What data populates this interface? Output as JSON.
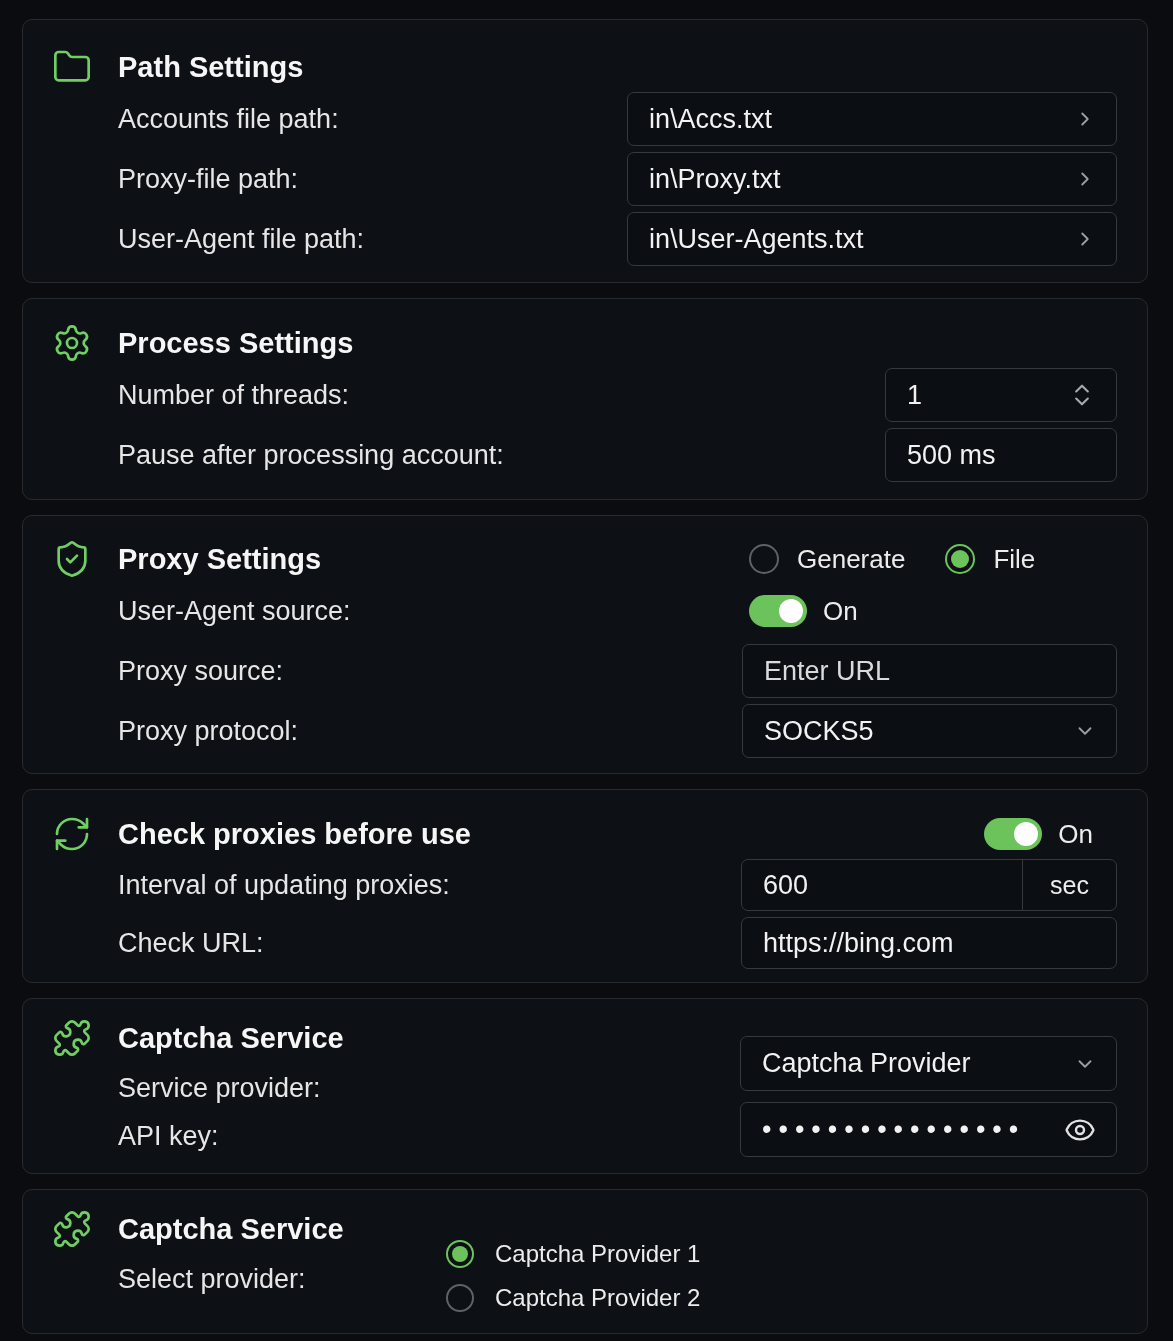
{
  "sections": [
    {
      "kind": "rows",
      "title": "Path Settings",
      "rows": [
        {
          "label": "Accounts file path:",
          "control": {
            "kind": "path",
            "value": "in\\Accs.txt"
          }
        },
        {
          "label": "Proxy-file path:",
          "control": {
            "kind": "path",
            "value": "in\\Proxy.txt"
          }
        },
        {
          "label": "User-Agent file path:",
          "control": {
            "kind": "path",
            "value": "in\\User-Agents.txt"
          }
        }
      ]
    },
    {
      "kind": "rows",
      "title": "Process Settings",
      "rows": [
        {
          "label": "Number of threads:",
          "control": {
            "kind": "stepper",
            "value": "1"
          }
        },
        {
          "label": "Pause after processing account:",
          "control": {
            "kind": "text",
            "value": "500 ms"
          }
        }
      ]
    },
    {
      "kind": "rows",
      "title": "Proxy Settings",
      "header_control": {
        "kind": "radios",
        "options": [
          {
            "label": "Generate",
            "selected": false
          },
          {
            "label": "File",
            "selected": true
          }
        ]
      },
      "rows": [
        {
          "label": "User-Agent source:",
          "control": {
            "kind": "toggle",
            "on": true,
            "label": "On"
          }
        },
        {
          "label": "Proxy source:",
          "control": {
            "kind": "text",
            "placeholder": "Enter URL"
          }
        },
        {
          "label": "Proxy protocol:",
          "control": {
            "kind": "select",
            "value": "SOCKS5"
          }
        }
      ]
    },
    {
      "kind": "rows",
      "title": "Check proxies before use",
      "header_control": {
        "kind": "toggle",
        "on": true,
        "label": "On"
      },
      "rows": [
        {
          "label": "Interval of updating proxies:",
          "control": {
            "kind": "unit",
            "value": "600",
            "unit": "sec"
          }
        },
        {
          "label": "Check URL:",
          "control": {
            "kind": "text",
            "value": "https://bing.com"
          }
        }
      ]
    },
    {
      "kind": "split",
      "title": "Captcha Service",
      "labels": [
        "Service provider:",
        "API key:"
      ],
      "controls": [
        {
          "kind": "select",
          "value": "Captcha Provider"
        },
        {
          "kind": "password",
          "value": "••••••••••••••••"
        }
      ]
    },
    {
      "kind": "split",
      "title": "Captcha Service",
      "labels": [
        "Select provider:"
      ],
      "controls": [
        {
          "kind": "radios",
          "options": [
            {
              "label": "Captcha Provider 1",
              "selected": true
            },
            {
              "label": "Captcha Provider 2",
              "selected": false
            }
          ]
        }
      ]
    }
  ]
}
